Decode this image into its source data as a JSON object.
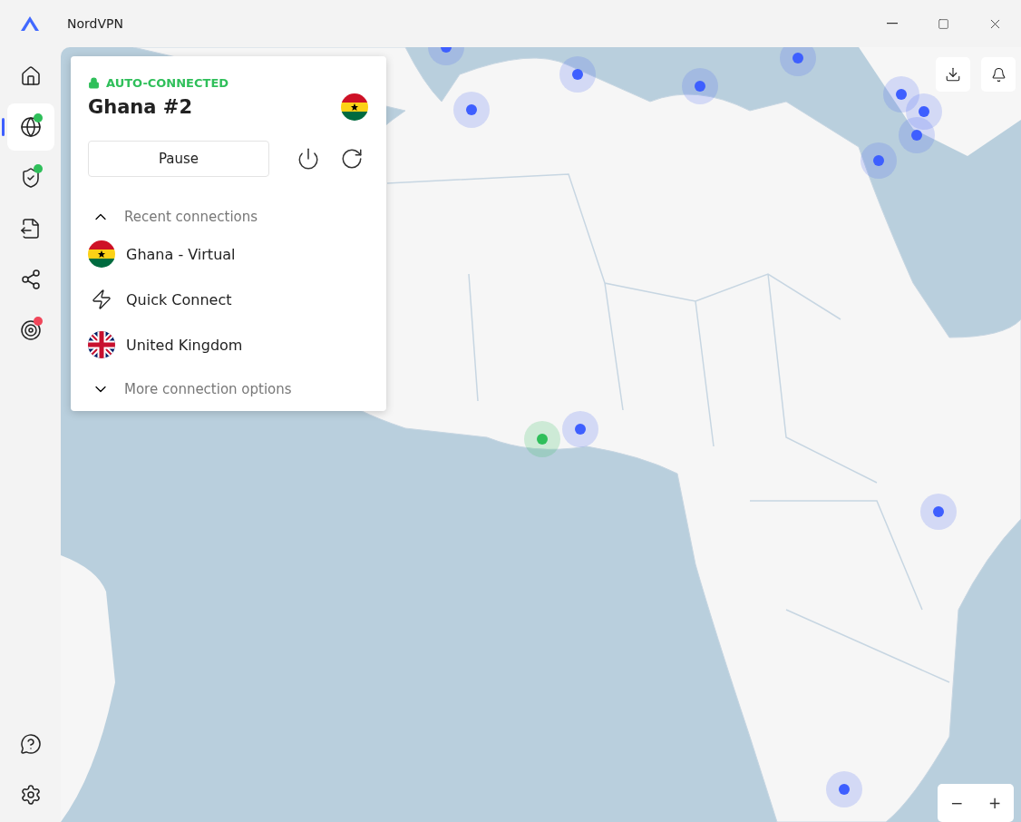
{
  "window": {
    "title": "NordVPN"
  },
  "sidebar": {
    "items": [
      {
        "kind": "home",
        "selected": false
      },
      {
        "kind": "globe",
        "selected": true,
        "color": "#2fbf5a"
      },
      {
        "kind": "shield",
        "selected": false,
        "color": "#2fbf5a"
      },
      {
        "kind": "file",
        "selected": false
      },
      {
        "kind": "mesh",
        "selected": false
      },
      {
        "kind": "target",
        "selected": false,
        "color": "#f0465a"
      }
    ],
    "bottom": [
      {
        "kind": "help"
      },
      {
        "kind": "settings"
      }
    ]
  },
  "connection": {
    "status": "AUTO-CONNECTED",
    "server": "Ghana #2",
    "pause": "Pause",
    "recent": {
      "title": "Recent connections",
      "expanded": true,
      "items": [
        {
          "kind": "ghana",
          "label": "Ghana - Virtual"
        },
        {
          "kind": "bolt",
          "label": "Quick Connect"
        },
        {
          "kind": "uk",
          "label": "United Kingdom"
        }
      ]
    },
    "more": "More connection options"
  },
  "map_controls": {
    "zoom_out": "−",
    "zoom_in": "+"
  }
}
